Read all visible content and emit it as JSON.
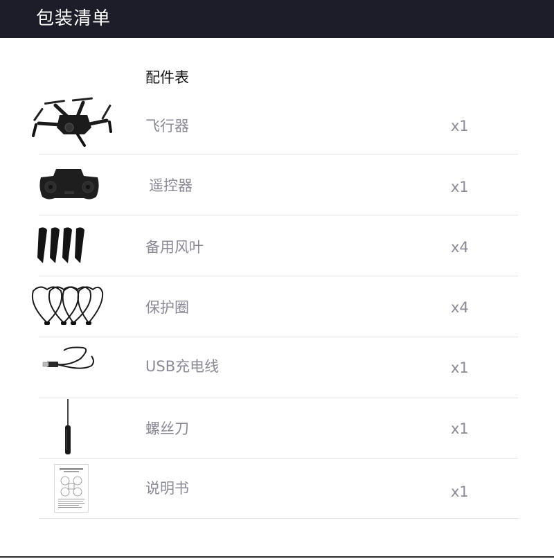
{
  "header": {
    "title": "包装清单"
  },
  "section": {
    "title": "配件表"
  },
  "items": [
    {
      "name": "飞行器",
      "qty": "x1",
      "icon": "drone-icon"
    },
    {
      "name": "遥控器",
      "qty": "x1",
      "icon": "remote-controller-icon"
    },
    {
      "name": "备用风叶",
      "qty": "x4",
      "icon": "propeller-icon"
    },
    {
      "name": "保护圈",
      "qty": "x4",
      "icon": "propeller-guard-icon"
    },
    {
      "name": "USB充电线",
      "qty": "x1",
      "icon": "usb-cable-icon"
    },
    {
      "name": "螺丝刀",
      "qty": "x1",
      "icon": "screwdriver-icon"
    },
    {
      "name": "说明书",
      "qty": "x1",
      "icon": "manual-icon"
    }
  ]
}
